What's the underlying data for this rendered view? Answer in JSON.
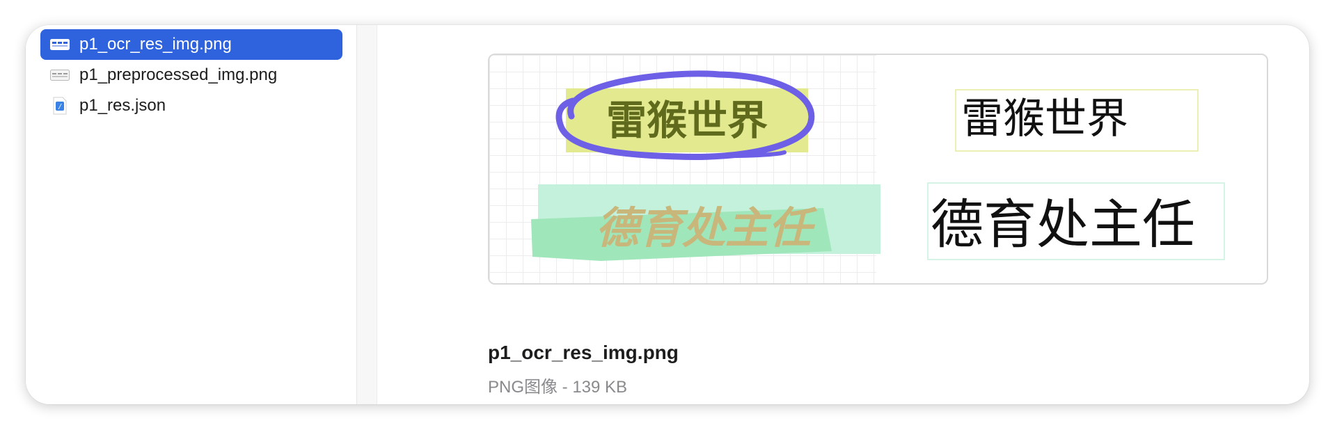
{
  "sidebar": {
    "files": [
      {
        "name": "p1_ocr_res_img.png",
        "icon": "image-file-icon",
        "selected": true
      },
      {
        "name": "p1_preprocessed_img.png",
        "icon": "image-file-icon",
        "selected": false
      },
      {
        "name": "p1_res.json",
        "icon": "json-file-icon",
        "selected": false
      }
    ]
  },
  "preview": {
    "left_texts": [
      "雷猴世界",
      "德育处主任"
    ],
    "right_texts": [
      "雷猴世界",
      "德育处主任"
    ],
    "colors": {
      "selection": "#2f63dd",
      "highlight_yellow": "#e2e98f",
      "highlight_green": "#9fe6bb",
      "circle_stroke": "#6d5fe6",
      "bold_text": "#5f6a1c",
      "brush_text": "#c8b67a"
    }
  },
  "info": {
    "filename": "p1_ocr_res_img.png",
    "meta": "PNG图像 - 139 KB"
  }
}
